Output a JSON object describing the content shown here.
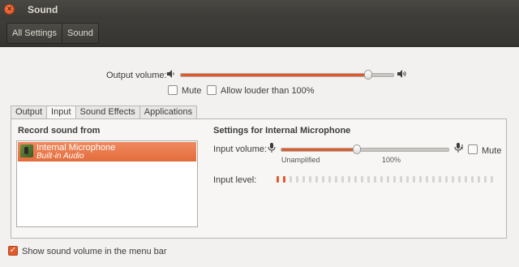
{
  "window": {
    "title": "Sound",
    "close_glyph": "×"
  },
  "toolbar": {
    "all_settings": "All Settings",
    "sound": "Sound"
  },
  "output": {
    "label": "Output volume:",
    "volume_fraction": 0.88,
    "mute_label": "Mute",
    "mute_checked": false,
    "allow_louder_label": "Allow louder than 100%",
    "allow_louder_checked": false
  },
  "tabs": [
    {
      "label": "Output",
      "active": false
    },
    {
      "label": "Input",
      "active": true
    },
    {
      "label": "Sound Effects",
      "active": false
    },
    {
      "label": "Applications",
      "active": false
    }
  ],
  "input": {
    "record_from_title": "Record sound from",
    "devices": [
      {
        "name": "Internal Microphone",
        "subtitle": "Built-in Audio",
        "selected": true
      }
    ],
    "settings_title": "Settings for Internal Microphone",
    "volume_label": "Input volume:",
    "volume_fraction": 0.45,
    "unamplified_label": "Unamplified",
    "hundred_label": "100%",
    "mute_label": "Mute",
    "mute_checked": false,
    "level_label": "Input level:",
    "level_segments_total": 34,
    "level_segments_lit": 2
  },
  "footer": {
    "show_in_menu_bar_label": "Show sound volume in the menu bar",
    "show_in_menu_bar_checked": true
  },
  "colors": {
    "accent": "#e05a2c",
    "titlebar": "#3b3a36"
  }
}
